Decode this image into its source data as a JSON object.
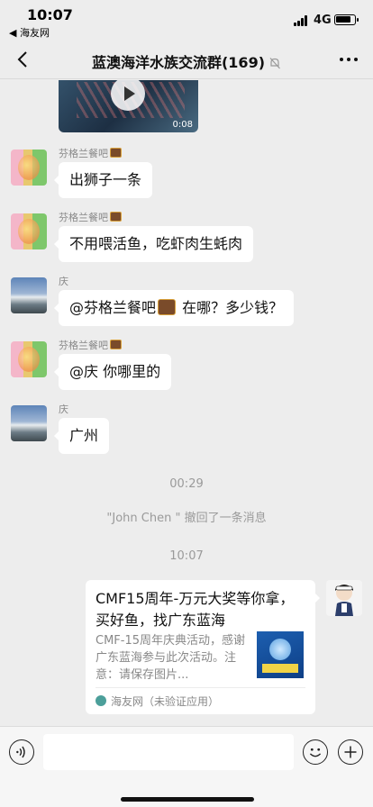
{
  "status_bar": {
    "time": "10:07",
    "back_app": "◀ 海友网",
    "network": "4G"
  },
  "nav": {
    "title": "蓝澳海洋水族交流群(169)"
  },
  "video": {
    "duration": "0:08"
  },
  "messages": [
    {
      "sender": "芬格兰餐吧",
      "text": "出狮子一条"
    },
    {
      "sender": "芬格兰餐吧",
      "text": "不用喂活鱼，吃虾肉生蚝肉"
    },
    {
      "sender": "庆",
      "text_before": "@芬格兰餐吧",
      "text_after": " 在哪？多少钱？"
    },
    {
      "sender": "芬格兰餐吧",
      "text": "@庆 你哪里的"
    },
    {
      "sender": "庆",
      "text": "广州"
    }
  ],
  "system": {
    "time1": "00:29",
    "recall": "\"John Chen \" 撤回了一条消息",
    "time2": "10:07"
  },
  "card": {
    "title": "CMF15周年-万元大奖等你拿，买好鱼，找广东蓝海",
    "desc": "CMF-15周年庆典活动，感谢广东蓝海参与此次活动。注意：请保存图片...",
    "source": "海友网（未验证应用）"
  }
}
